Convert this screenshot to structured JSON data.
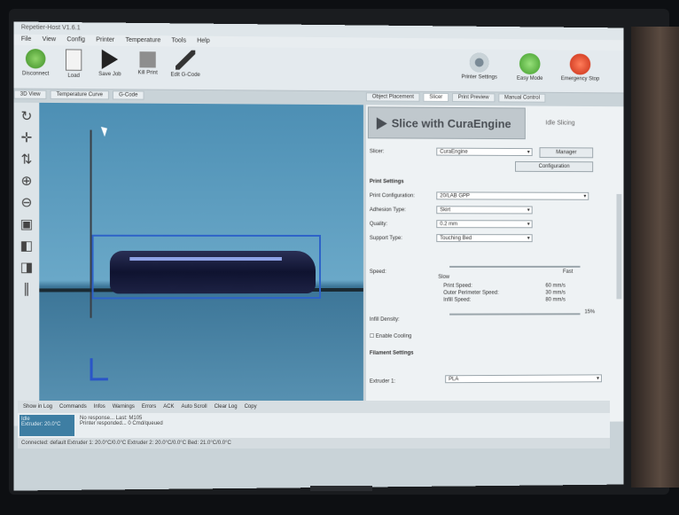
{
  "window": {
    "title": "Repetier-Host V1.6.1"
  },
  "menu": [
    "File",
    "View",
    "Config",
    "Printer",
    "Temperature",
    "Tools",
    "Help"
  ],
  "toolbar": {
    "connect": "Disconnect",
    "load": "Load",
    "save": "Save Job",
    "run": "Run Job",
    "kill": "Kill Print",
    "edit": "Edit G-Code",
    "printer_settings": "Printer Settings",
    "easy_mode": "Easy Mode",
    "emergency": "Emergency Stop"
  },
  "left_tabs": [
    "3D View",
    "Temperature Curve",
    "G-Code"
  ],
  "right_tabs": [
    "Object Placement",
    "Slicer",
    "Print Preview",
    "Manual Control"
  ],
  "slicer": {
    "slice_label": "Slice with CuraEngine",
    "status": "Idle Slicing",
    "slicer_label": "Slicer:",
    "slicer_value": "CuraEngine",
    "manager": "Manager",
    "configuration": "Configuration",
    "print_settings": "Print Settings",
    "print_config_label": "Print Configuration:",
    "print_config_value": "20/LAB GPP",
    "adhesion_label": "Adhesion Type:",
    "adhesion_value": "Skirt",
    "quality_label": "Quality:",
    "quality_value": "0.2 mm",
    "support_label": "Support Type:",
    "support_value": "Touching Bed",
    "speed_label": "Speed:",
    "speed_fast": "Fast",
    "speed_slow": "Slow",
    "speed_rows": [
      [
        "Print Speed:",
        "60 mm/s"
      ],
      [
        "Outer Perimeter Speed:",
        "30 mm/s"
      ],
      [
        "Infill Speed:",
        "80 mm/s"
      ]
    ],
    "infill_label": "Infill Density:",
    "infill_value": "15%",
    "cooling_label": "Enable Cooling",
    "filament_settings": "Filament Settings",
    "extruder_label": "Extruder 1:",
    "extruder_value": "PLA"
  },
  "bottom_tabs": [
    "Show in Log",
    "Commands",
    "Infos",
    "Warnings",
    "Errors",
    "ACK",
    "Auto Scroll",
    "Clear Log",
    "Copy"
  ],
  "console": {
    "badge_lines": [
      "Idle",
      "Extruder: 20.0°C"
    ],
    "log_lines": [
      "No response... Last: M105",
      "Printer responded... 0 Cmd/queued"
    ]
  },
  "statusbar": "Connected: default    Extruder 1: 20.0°C/0.0°C Extruder 2: 20.0°C/0.0°C Bed: 21.0°C/0.0°C"
}
